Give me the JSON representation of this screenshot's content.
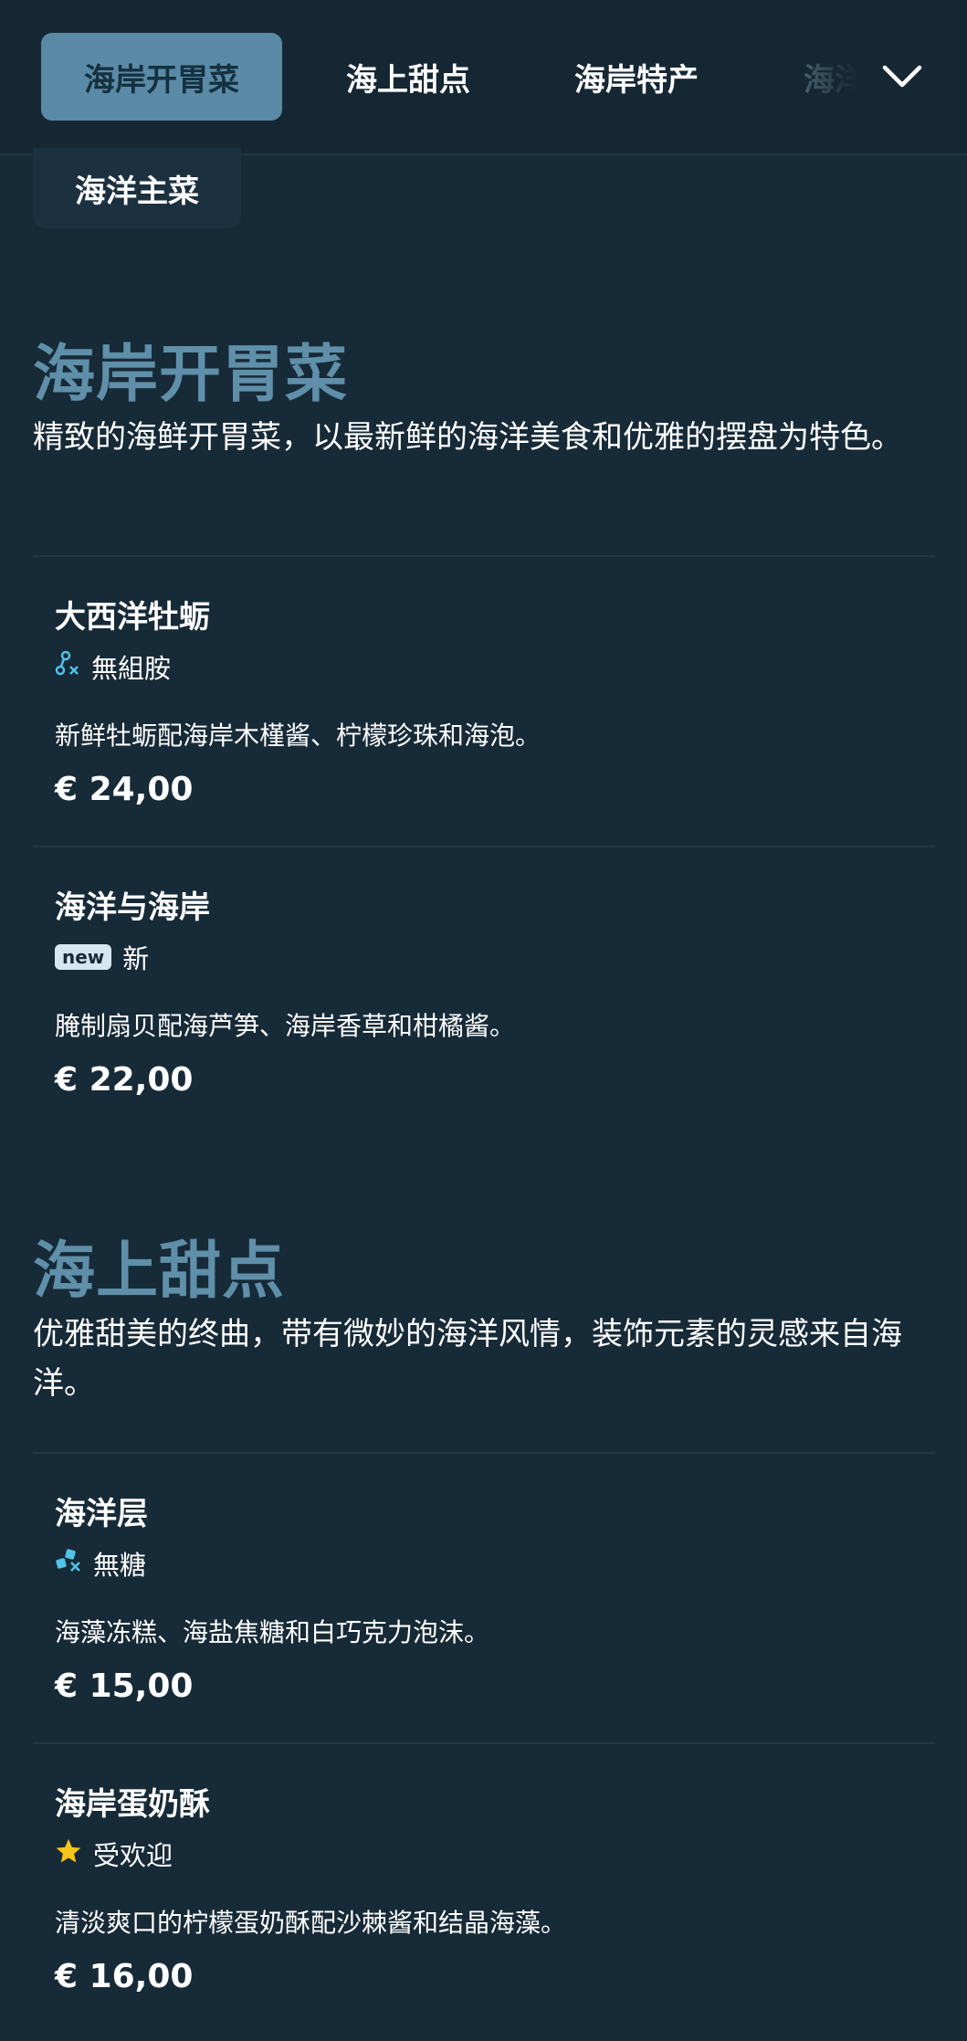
{
  "tabs": [
    {
      "label": "海岸开胃菜"
    },
    {
      "label": "海上甜点"
    },
    {
      "label": "海岸特产"
    },
    {
      "label": "海洋主菜"
    }
  ],
  "sections": [
    {
      "title": "海岸开胃菜",
      "description": "精致的海鲜开胃菜，以最新鲜的海洋美食和优雅的摆盘为特色。",
      "items": [
        {
          "name": "大西洋牡蛎",
          "tag_icon": "histamine-free-icon",
          "tag": "無組胺",
          "description": "新鲜牡蛎配海岸木槿酱、柠檬珍珠和海泡。",
          "price": "€ 24,00"
        },
        {
          "name": "海洋与海岸",
          "tag_icon": "new-badge",
          "badge": "new",
          "tag": "新",
          "description": "腌制扇贝配海芦笋、海岸香草和柑橘酱。",
          "price": "€ 22,00"
        }
      ]
    },
    {
      "title": "海上甜点",
      "description": "优雅甜美的终曲，带有微妙的海洋风情，装饰元素的灵感来自海洋。",
      "items": [
        {
          "name": "海洋层",
          "tag_icon": "sugar-free-icon",
          "tag": "無糖",
          "description": "海藻冻糕、海盐焦糖和白巧克力泡沫。",
          "price": "€ 15,00"
        },
        {
          "name": "海岸蛋奶酥",
          "tag_icon": "star-icon",
          "tag": "受欢迎",
          "description": "清淡爽口的柠檬蛋奶酥配沙棘酱和结晶海藻。",
          "price": "€ 16,00"
        }
      ]
    }
  ],
  "colors": {
    "background": "#172a37",
    "accent": "#5f8fa9",
    "active_tab": "#5a8aa5",
    "tag_icon": "#4fc3e8",
    "star": "#f5c518"
  }
}
